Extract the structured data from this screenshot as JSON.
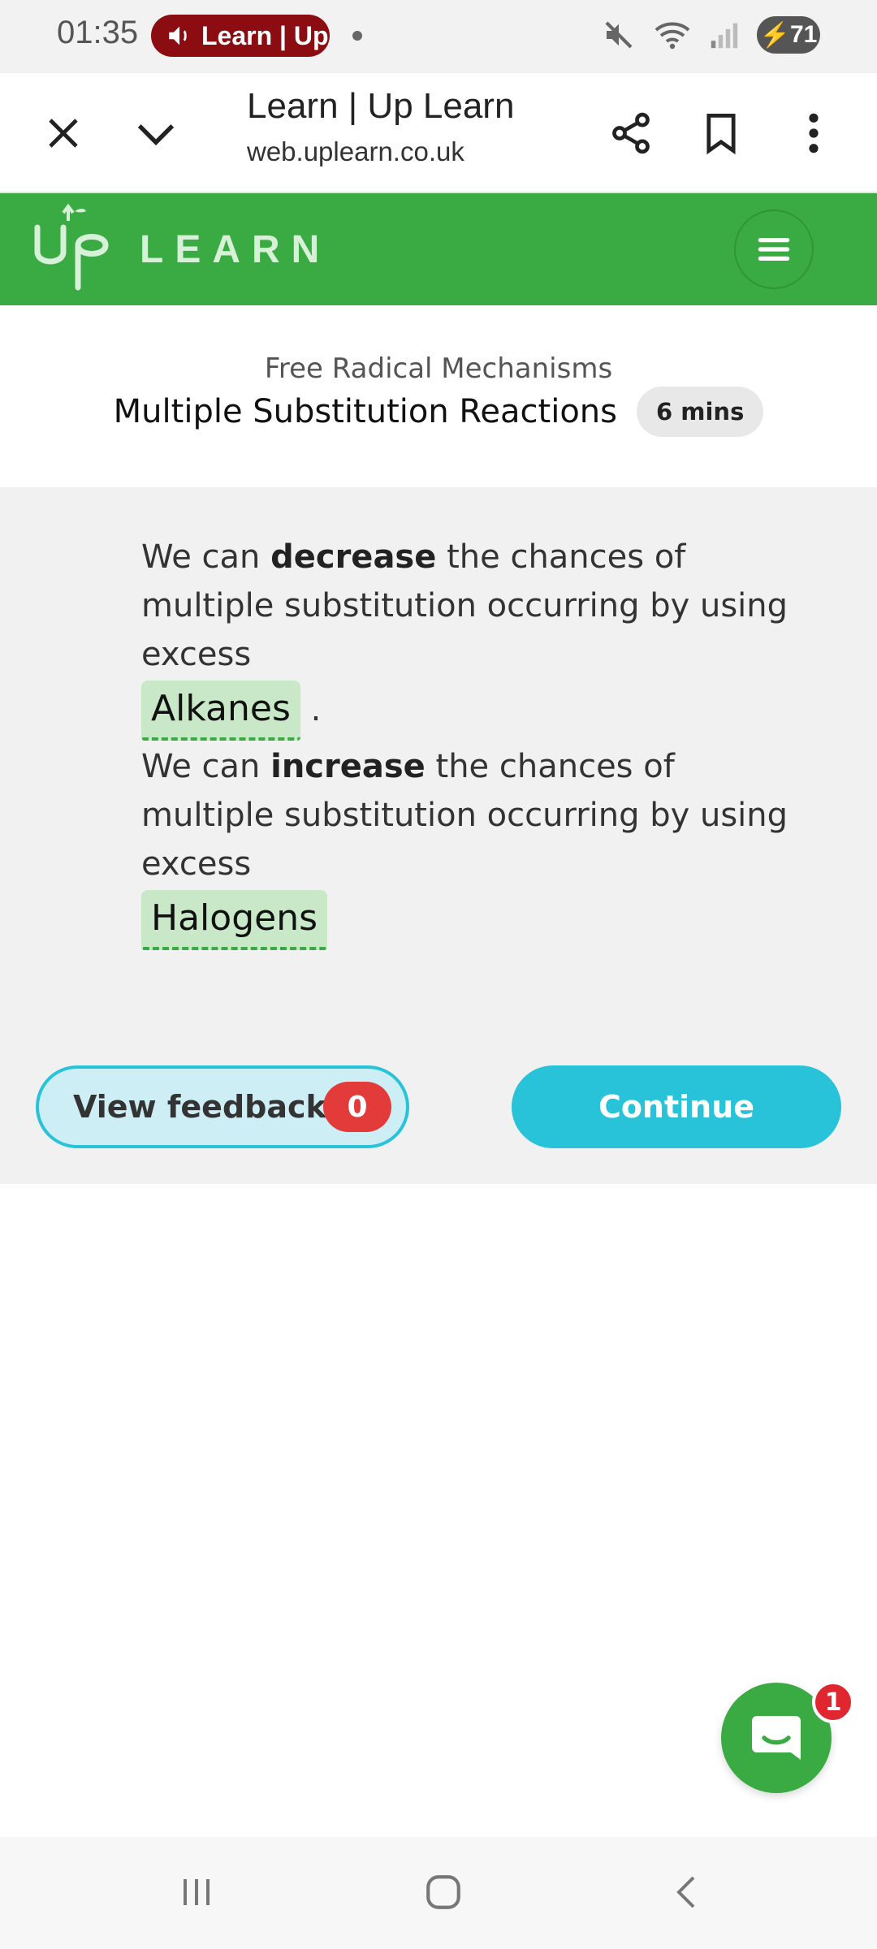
{
  "status_bar": {
    "time": "01:35",
    "media_label": "Learn | Up",
    "battery": "71",
    "icons": [
      "volume-icon",
      "mute-icon",
      "wifi-icon",
      "signal-icon",
      "battery-icon"
    ]
  },
  "browser": {
    "page_title": "Learn | Up Learn",
    "url": "web.uplearn.co.uk",
    "icons": [
      "close-icon",
      "chevron-down-icon",
      "share-icon",
      "bookmark-icon",
      "more-vert-icon"
    ]
  },
  "site": {
    "logo_text": "LEARN",
    "brand_color": "#3aaa42",
    "icons": [
      "up-logo-icon",
      "hamburger-menu-icon"
    ]
  },
  "lesson": {
    "topic": "Free Radical Mechanisms",
    "title": "Multiple Substitution Reactions",
    "duration": "6 mins"
  },
  "content": {
    "q1": {
      "prefix": "We can ",
      "emphasis": "decrease",
      "rest": " the chances of multiple substitution occurring by using excess",
      "answer": "Alkanes",
      "suffix": "."
    },
    "q2": {
      "prefix": "We can ",
      "emphasis": "increase",
      "rest": " the chances of multiple substitution occurring by using excess",
      "answer": "Halogens"
    }
  },
  "actions": {
    "feedback_label": "View feedback",
    "feedback_count": "0",
    "continue_label": "Continue",
    "accent_color": "#28c3d8"
  },
  "chat": {
    "badge_count": "1"
  },
  "nav": {
    "icons": [
      "recent-apps-icon",
      "home-icon",
      "back-icon"
    ]
  }
}
